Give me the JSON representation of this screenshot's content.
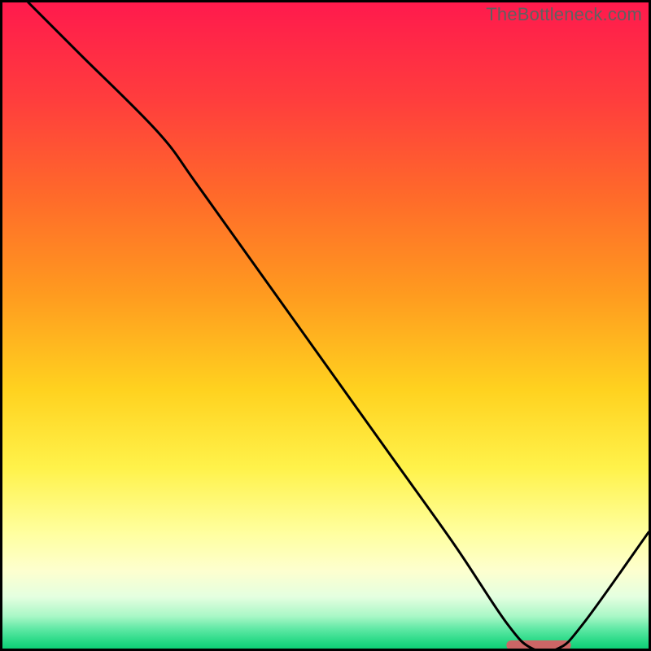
{
  "watermark": "TheBottleneck.com",
  "chart_data": {
    "type": "line",
    "title": "",
    "xlabel": "",
    "ylabel": "",
    "xlim": [
      0,
      100
    ],
    "ylim": [
      0,
      100
    ],
    "series": [
      {
        "name": "curve",
        "x": [
          4,
          12,
          24,
          30,
          40,
          50,
          60,
          70,
          78,
          82,
          86,
          90,
          100
        ],
        "values": [
          100,
          92,
          80,
          72,
          58,
          44,
          30,
          16,
          4,
          0,
          0,
          4,
          18
        ]
      }
    ],
    "highlight_segment": {
      "x_start": 78,
      "x_end": 88,
      "y": 0
    },
    "gradient_stops": [
      {
        "offset": 0,
        "color": "#ff1a4d"
      },
      {
        "offset": 15,
        "color": "#ff3d3d"
      },
      {
        "offset": 30,
        "color": "#ff6a2a"
      },
      {
        "offset": 45,
        "color": "#ff9a1f"
      },
      {
        "offset": 60,
        "color": "#ffd21f"
      },
      {
        "offset": 72,
        "color": "#fff24a"
      },
      {
        "offset": 82,
        "color": "#ffff9e"
      },
      {
        "offset": 88,
        "color": "#fdffcf"
      },
      {
        "offset": 92,
        "color": "#e4ffe0"
      },
      {
        "offset": 95,
        "color": "#a9f7c6"
      },
      {
        "offset": 97,
        "color": "#5ee8a4"
      },
      {
        "offset": 99,
        "color": "#24d884"
      },
      {
        "offset": 100,
        "color": "#0fcf76"
      }
    ]
  }
}
